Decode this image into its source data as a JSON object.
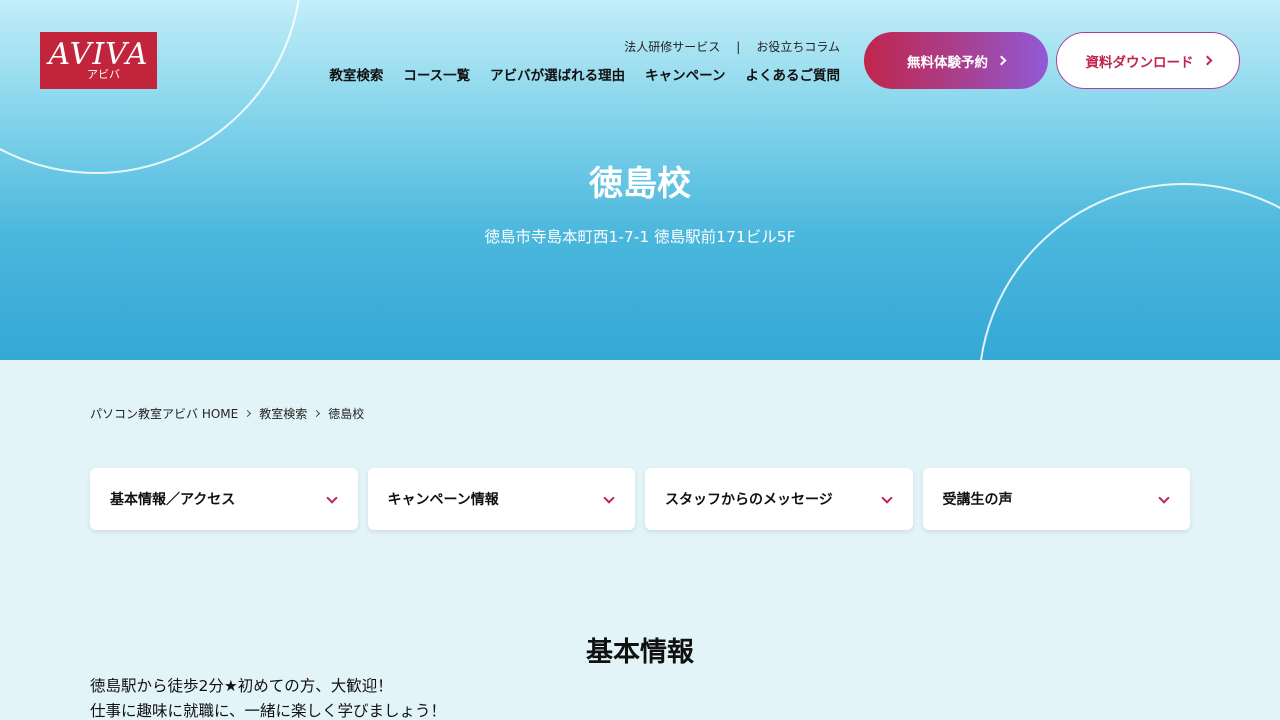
{
  "header": {
    "logo_text": "AVIVA",
    "logo_sub": "アビバ",
    "subnav": {
      "corporate": "法人研修サービス",
      "separator": "|",
      "column": "お役立ちコラム"
    },
    "mainnav": [
      "教室検索",
      "コース一覧",
      "アビバが選ばれる理由",
      "キャンペーン",
      "よくあるご質問"
    ],
    "trial_button": "無料体験予約",
    "download_button": "資料ダウンロード"
  },
  "hero": {
    "title": "徳島校",
    "address": "徳島市寺島本町西1-7-1 徳島駅前171ビル5F"
  },
  "breadcrumb": [
    "パソコン教室アビバ HOME",
    "教室検索",
    "徳島校"
  ],
  "tabs": [
    "基本情報／アクセス",
    "キャンペーン情報",
    "スタッフからのメッセージ",
    "受講生の声"
  ],
  "section": {
    "title": "基本情報",
    "lines": [
      "徳島駅から徒歩2分★初めての方、大歓迎！",
      "仕事に趣味に就職に、一緒に楽しく学びましょう！"
    ]
  },
  "colors": {
    "accent": "#c0264c",
    "gradient_end": "#915ad6",
    "hero_bottom": "#35a8d6",
    "page_bg": "#e3f4f8"
  }
}
